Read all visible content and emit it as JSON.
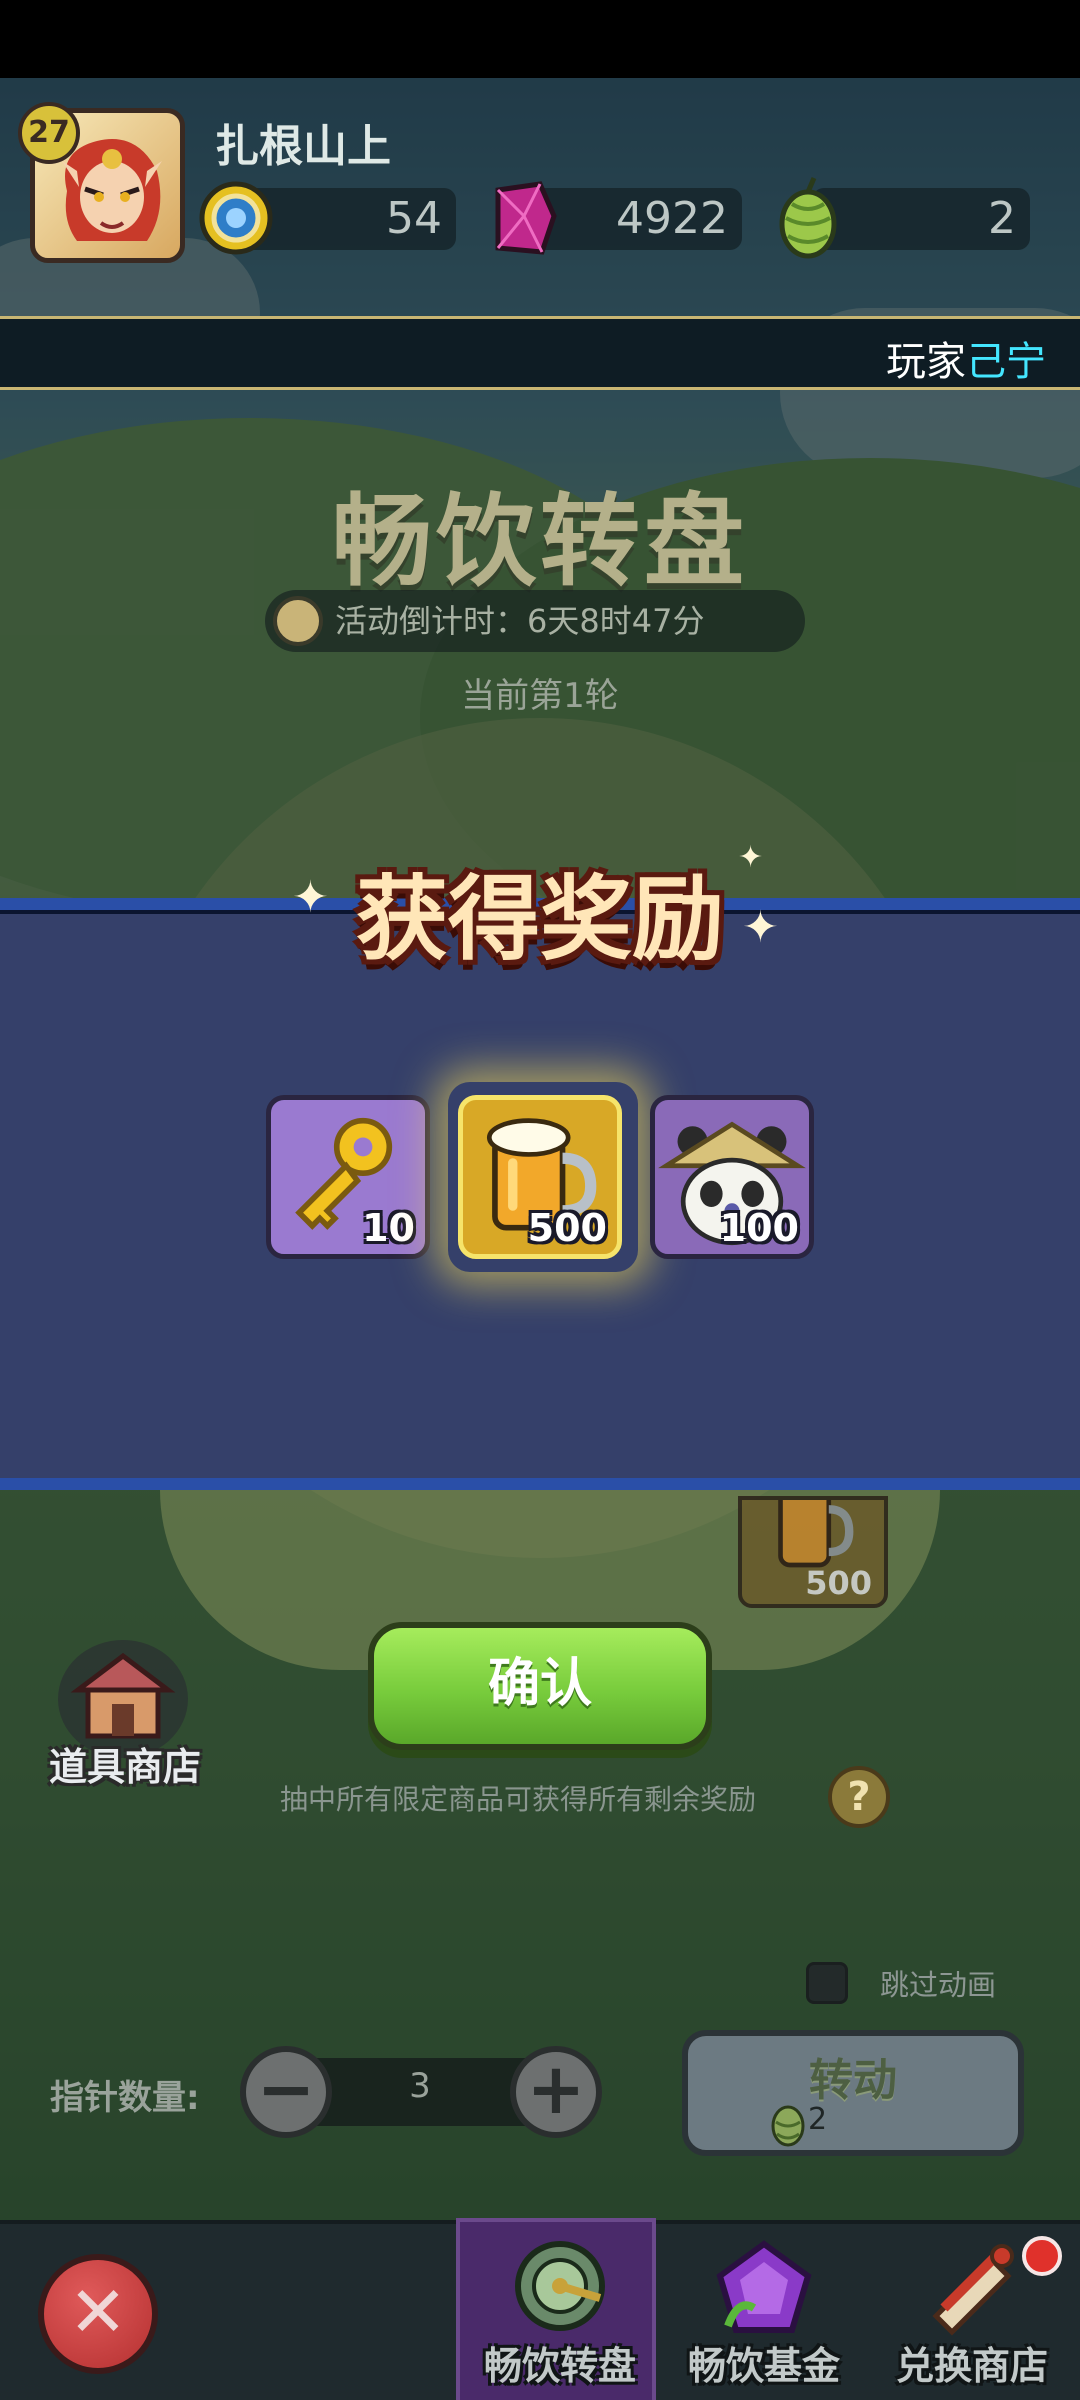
{
  "player": {
    "level": "27",
    "name": "扎根山上",
    "coins": "54",
    "gems": "4922",
    "hops": "2"
  },
  "banner": {
    "prefix": "玩家",
    "highlight": "己宁"
  },
  "event": {
    "title": "畅饮转盘",
    "countdown": "活动倒计时：6天8时47分",
    "round": "当前第1轮"
  },
  "popup": {
    "title": "获得奖励",
    "rewards": [
      {
        "icon": "golden-key-icon",
        "qty": "10"
      },
      {
        "icon": "beer-mug-icon",
        "qty": "500"
      },
      {
        "icon": "panda-character-icon",
        "qty": "100"
      }
    ],
    "confirm_label": "确认"
  },
  "wheel_peek_qty": "500",
  "side": {
    "shop_label": "道具商店",
    "hint": "抽中所有限定商品可获得所有剩余奖励",
    "help": "?"
  },
  "controls": {
    "skip_label": "跳过动画",
    "pointer_label": "指针数量:",
    "pointer_value": "3",
    "minus": "−",
    "plus": "+",
    "spin_label": "转动",
    "spin_cost": "2"
  },
  "nav": {
    "close": "✕",
    "tabs": [
      {
        "label": "畅饮转盘",
        "active": true
      },
      {
        "label": "畅饮基金",
        "active": false
      },
      {
        "label": "兑换商店",
        "active": false
      }
    ]
  },
  "colors": {
    "accent_green": "#78cc3c",
    "popup_blue": "#35406a",
    "highlight_cyan": "#44e6ff"
  }
}
